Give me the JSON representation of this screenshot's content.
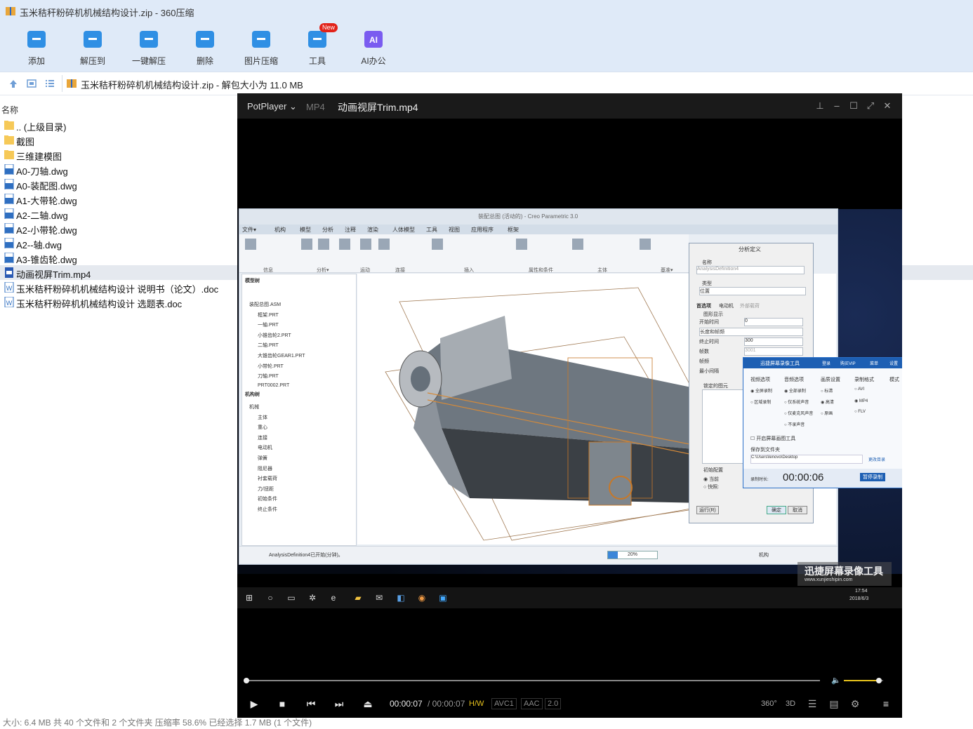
{
  "window": {
    "title": "玉米秸秆粉碎机机械结构设计.zip - 360压缩"
  },
  "toolbar": [
    {
      "label": "添加",
      "icon": "add-icon",
      "color": "#2f8fe4"
    },
    {
      "label": "解压到",
      "icon": "extract-to-icon",
      "color": "#2f8fe4"
    },
    {
      "label": "一键解压",
      "icon": "one-key-extract-icon",
      "color": "#2f8fe4"
    },
    {
      "label": "删除",
      "icon": "delete-icon",
      "color": "#2f8fe4"
    },
    {
      "label": "图片压缩",
      "icon": "image-compress-icon",
      "color": "#2f8fe4"
    },
    {
      "label": "工具",
      "icon": "tools-icon",
      "color": "#2f8fe4",
      "badge": "New"
    },
    {
      "label": "AI办公",
      "icon": "ai-office-icon",
      "color": "#7a5cf0",
      "glyph": "AI"
    }
  ],
  "address": {
    "path": "玉米秸秆粉碎机机械结构设计.zip - 解包大小为 11.0 MB"
  },
  "list": {
    "column_name": "名称",
    "items": [
      {
        "name": ".. (上级目录)",
        "type": "folder"
      },
      {
        "name": "截图",
        "type": "folder"
      },
      {
        "name": "三维建模图",
        "type": "folder"
      },
      {
        "name": "A0-刀轴.dwg",
        "type": "dwg"
      },
      {
        "name": "A0-装配图.dwg",
        "type": "dwg"
      },
      {
        "name": "A1-大带轮.dwg",
        "type": "dwg"
      },
      {
        "name": "A2-二轴.dwg",
        "type": "dwg"
      },
      {
        "name": "A2-小带轮.dwg",
        "type": "dwg"
      },
      {
        "name": "A2--轴.dwg",
        "type": "dwg"
      },
      {
        "name": "A3-锥齿轮.dwg",
        "type": "dwg"
      },
      {
        "name": "动画视屏Trim.mp4",
        "type": "mp4",
        "selected": true
      },
      {
        "name": "玉米秸秆粉碎机机械结构设计 说明书（论文）.doc",
        "type": "doc"
      },
      {
        "name": "玉米秸秆粉碎机机械结构设计 选题表.doc",
        "type": "doc"
      }
    ]
  },
  "status": {
    "text": "大小: 6.4 MB 共 40 个文件和 2 个文件夹 压缩率 58.6% 已经选择 1.7 MB (1 个文件)"
  },
  "player": {
    "brand": "PotPlayer",
    "format": "MP4",
    "file": "动画视屏Trim.mp4",
    "time_current": "00:00:07",
    "time_total": "/ 00:00:07",
    "hw": "H/W",
    "codec_video": "AVC1",
    "codec_audio": "AAC",
    "channels": "2.0",
    "progress": 1.0,
    "volume": 0.9,
    "buttons": [
      "play-icon",
      "stop-icon",
      "prev-icon",
      "next-icon",
      "eject-icon",
      "360-icon",
      "3d-icon",
      "playlist-search-icon",
      "chapters-icon",
      "settings-icon",
      "menu-icon"
    ],
    "btn_360": "360°",
    "btn_3d": "3D"
  },
  "video": {
    "creo_title": "装配总图 (活动的) - Creo Parametric 3.0",
    "creo_menus": [
      "文件▾",
      "机构",
      "模型",
      "分析",
      "注释",
      "渲染",
      "人体模型",
      "工具",
      "视图",
      "应用程序",
      "框架"
    ],
    "creo_groups": [
      "信息",
      "分析▾",
      "运动",
      "连接",
      "插入",
      "属性和条件",
      "主体",
      "基准▾"
    ],
    "tree_model_header": "模型树",
    "tree_model": [
      "装配总图.ASM",
      "框架.PRT",
      "一轴.PRT",
      "小锥齿轮2.PRT",
      "二轴.PRT",
      "大锥齿轮GEAR1.PRT",
      "小带轮.PRT",
      "刀轴.PRT",
      "PRT0002.PRT"
    ],
    "tree_mech_header": "机构树",
    "tree_mech": [
      "机械",
      "主体",
      "重心",
      "连接",
      "电动机",
      "弹簧",
      "阻尼器",
      "衬套载荷",
      "力/扭距",
      "初始条件",
      "终止条件"
    ],
    "msg": "AnalysisDefinition4已开始(分钟)。",
    "progress_pct": "20%",
    "mech_field": "机构",
    "dialog": {
      "title": "分析定义",
      "name_label": "名称",
      "name_value": "AnalysisDefinition4",
      "type_label": "类型",
      "type_value": "位置",
      "tab1": "首选项",
      "tab2": "电动机",
      "tab3": "外部载荷",
      "graph": "图形显示",
      "start_time": "开始时间",
      "start_value": "0",
      "length_rate": "长度和帧频",
      "end_time": "终止时间",
      "end_value": "300",
      "frames": "帧数",
      "frames_value": "3001",
      "frame_rate": "帧频",
      "min_interval": "最小间隔",
      "locked": "锁定的图元",
      "init": "初始配置",
      "current": "当前",
      "snapshot": "快照:",
      "run": "运行(R)",
      "ok": "确定",
      "cancel": "取消"
    },
    "recorder": {
      "title": "迅捷屏幕录像工具",
      "login": "登录",
      "buy": "购买VIP",
      "menu": "菜单",
      "settings": "设置",
      "sections": [
        "视频选项",
        "音频选项",
        "画质设置",
        "录制格式",
        "模式"
      ],
      "video_opts": [
        "全屏录制",
        "区域录制"
      ],
      "audio_opts": [
        "全部录制",
        "仅系统声音",
        "仅麦克风声音",
        "不录声音"
      ],
      "quality_opts": [
        "标清",
        "高清",
        "原画"
      ],
      "format_opts": [
        "AVI",
        "MP4",
        "FLV"
      ],
      "shortcut": "开启屏幕画图工具",
      "save_to": "保存到文件夹",
      "save_path": "C:\\Users\\lenovo\\Desktop",
      "change_dir": "更改目录",
      "rec_time_label": "录制时长:",
      "rec_time": "00:00:06",
      "pause_btn": "暂停录制"
    },
    "watermark": "迅捷屏幕录像工具",
    "watermark_url": "www.xunjieshipin.com",
    "clock_time": "17:54",
    "clock_date": "2018/6/3"
  }
}
